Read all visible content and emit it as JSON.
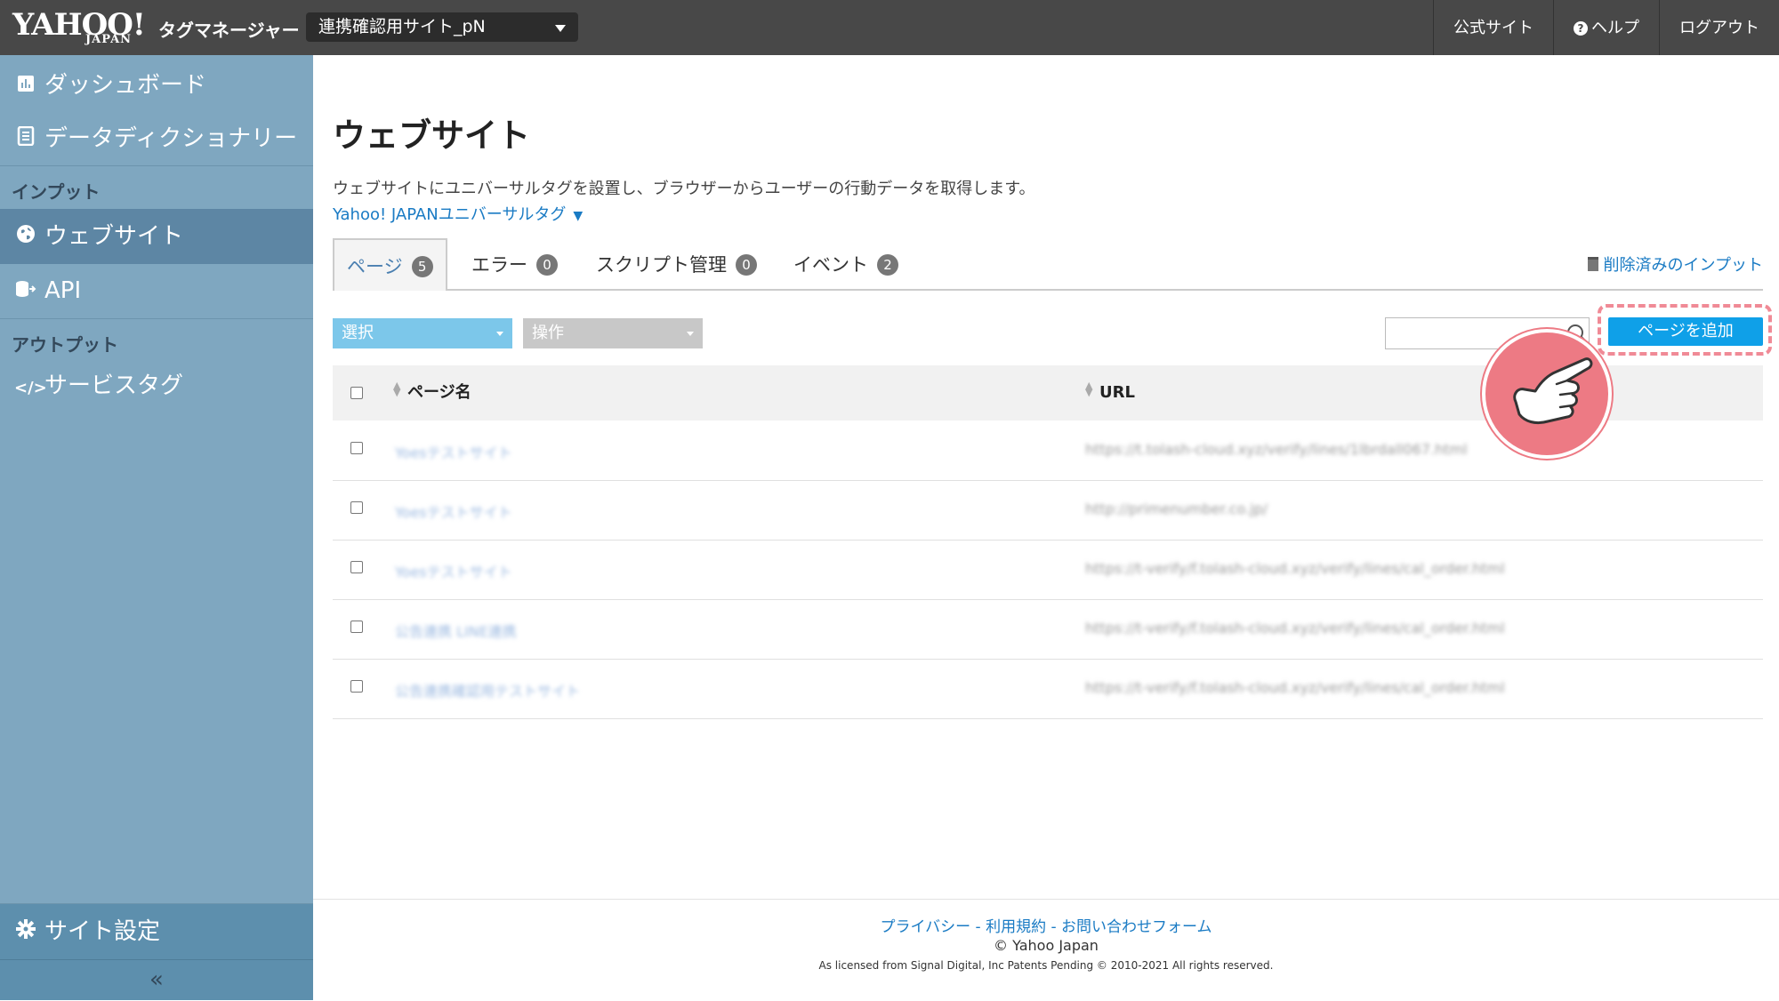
{
  "header": {
    "logo_main": "YAHOO!",
    "logo_sub": "JAPAN",
    "product": "タグマネージャー",
    "site_selector": "連携確認用サイト_pN",
    "nav": [
      "公式サイト",
      "ヘルプ",
      "ログアウト"
    ]
  },
  "sidebar": {
    "dashboard": "ダッシュボード",
    "data_dictionary": "データディクショナリー",
    "input_heading": "インプット",
    "website": "ウェブサイト",
    "api": "API",
    "output_heading": "アウトプット",
    "service_tag": "サービスタグ",
    "site_settings": "サイト設定",
    "collapse": "«"
  },
  "main": {
    "title": "ウェブサイト",
    "description": "ウェブサイトにユニバーサルタグを設置し、ブラウザーからユーザーの行動データを取得します。",
    "universal_tag_link": "Yahoo! JAPANユニバーサルタグ",
    "universal_tag_caret": "▼",
    "tabs": [
      {
        "label": "ページ",
        "count": "5"
      },
      {
        "label": "エラー",
        "count": "0"
      },
      {
        "label": "スクリプト管理",
        "count": "0"
      },
      {
        "label": "イベント",
        "count": "2"
      }
    ],
    "deleted_inputs": "削除済みのインプット",
    "select_dropdown": "選択",
    "operation_dropdown": "操作",
    "search_placeholder": "",
    "add_page_button": "ページを追加",
    "table": {
      "headers": [
        "ページ名",
        "URL"
      ],
      "rows": [
        {
          "name": "Yoesテストサイト",
          "url": "https://t.tolash-cloud.xyz/verify/lines/1lbrdall067.html"
        },
        {
          "name": "Yoesテストサイト",
          "url": "http://primenumber.co.jp/"
        },
        {
          "name": "Yoesテストサイト",
          "url": "https://t-verify/f.tolash-cloud.xyz/verify/lines/cal_order.html"
        },
        {
          "name": "公告連携 LINE連携",
          "url": "https://t-verify/f.tolash-cloud.xyz/verify/lines/cal_order.html"
        },
        {
          "name": "公告連携確認用テストサイト",
          "url": "https://t-verify/f.tolash-cloud.xyz/verify/lines/cal_order.html"
        }
      ]
    }
  },
  "footer": {
    "links": "プライバシー - 利用規約 - お問い合わせフォーム",
    "copyright": "© Yahoo Japan",
    "license": "As licensed from Signal Digital, Inc Patents Pending © 2010-2021 All rights reserved."
  },
  "colors": {
    "topbar": "#484848",
    "sidebar": "#7fa7c0",
    "sidebar_active": "#5d86a4",
    "accent": "#0fa0e8",
    "select_dropdown": "#7cc7ea",
    "operation_dropdown": "#c8c8c8",
    "pointer": "#ed7a84"
  },
  "icons": [
    "dashboard-icon",
    "dictionary-icon",
    "globe-icon",
    "api-icon",
    "code-icon",
    "gear-icon",
    "help-icon",
    "trash-icon",
    "search-icon",
    "pointing-hand-icon"
  ]
}
